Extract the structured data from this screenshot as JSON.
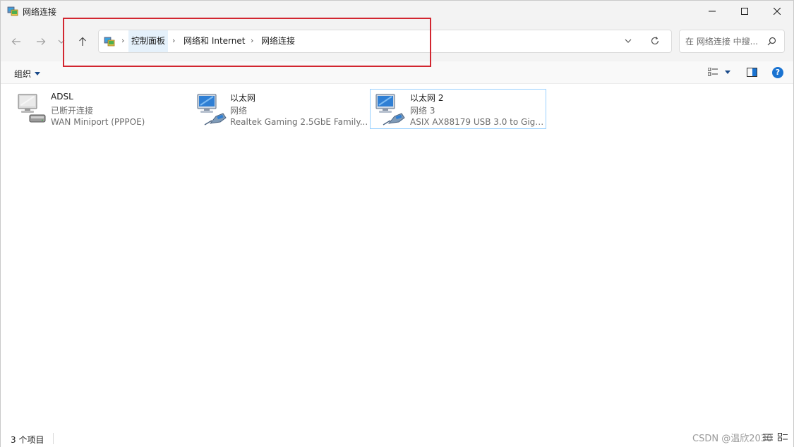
{
  "window": {
    "title": "网络连接"
  },
  "nav": {
    "breadcrumbs": [
      {
        "label": "控制面板"
      },
      {
        "label": "网络和 Internet"
      },
      {
        "label": "网络连接"
      }
    ],
    "search_placeholder": "在 网络连接 中搜..."
  },
  "toolbar": {
    "organize_label": "组织"
  },
  "help": {
    "label": "?"
  },
  "items": [
    {
      "name": "ADSL",
      "status": "已断开连接",
      "device": "WAN Miniport (PPPOE)",
      "icon": "dialup-connection-icon"
    },
    {
      "name": "以太网",
      "status": "网络",
      "device": "Realtek Gaming 2.5GbE Family...",
      "icon": "ethernet-connection-icon"
    },
    {
      "name": "以太网 2",
      "status": "网络 3",
      "device": "ASIX AX88179 USB 3.0 to Giga...",
      "icon": "ethernet-connection-icon"
    }
  ],
  "status": {
    "item_count": "3 个项目",
    "watermark": "CSDN @温欣2030"
  },
  "colors": {
    "highlight_box": "#d22630",
    "selection_border": "#99d1ff",
    "help_blue": "#1a73d1"
  }
}
